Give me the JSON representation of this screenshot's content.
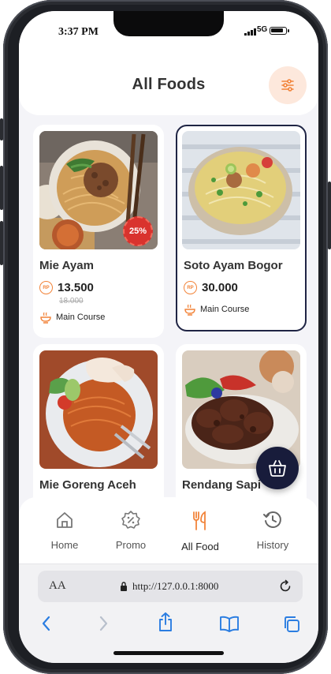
{
  "status": {
    "time": "3:37 PM",
    "network": "5G"
  },
  "header": {
    "title": "All Foods"
  },
  "foods": [
    {
      "name": "Mie Ayam",
      "price": "13.500",
      "old_price": "18.000",
      "category": "Main Course",
      "discount": "25%"
    },
    {
      "name": "Soto Ayam Bogor",
      "price": "30.000",
      "category": "Main Course"
    },
    {
      "name": "Mie Goreng Aceh"
    },
    {
      "name": "Rendang Sapi"
    }
  ],
  "currency_label": "RP",
  "nav": {
    "items": [
      {
        "label": "Home",
        "icon": "home-icon"
      },
      {
        "label": "Promo",
        "icon": "percent-badge-icon"
      },
      {
        "label": "All Food",
        "icon": "fork-spoon-icon"
      },
      {
        "label": "History",
        "icon": "history-icon"
      }
    ],
    "active": "All Food"
  },
  "browser": {
    "aa": "AA",
    "url": "http://127.0.0.1:8000"
  },
  "colors": {
    "accent": "#f2843a",
    "dark": "#181c3b",
    "badge": "#d9332e"
  }
}
